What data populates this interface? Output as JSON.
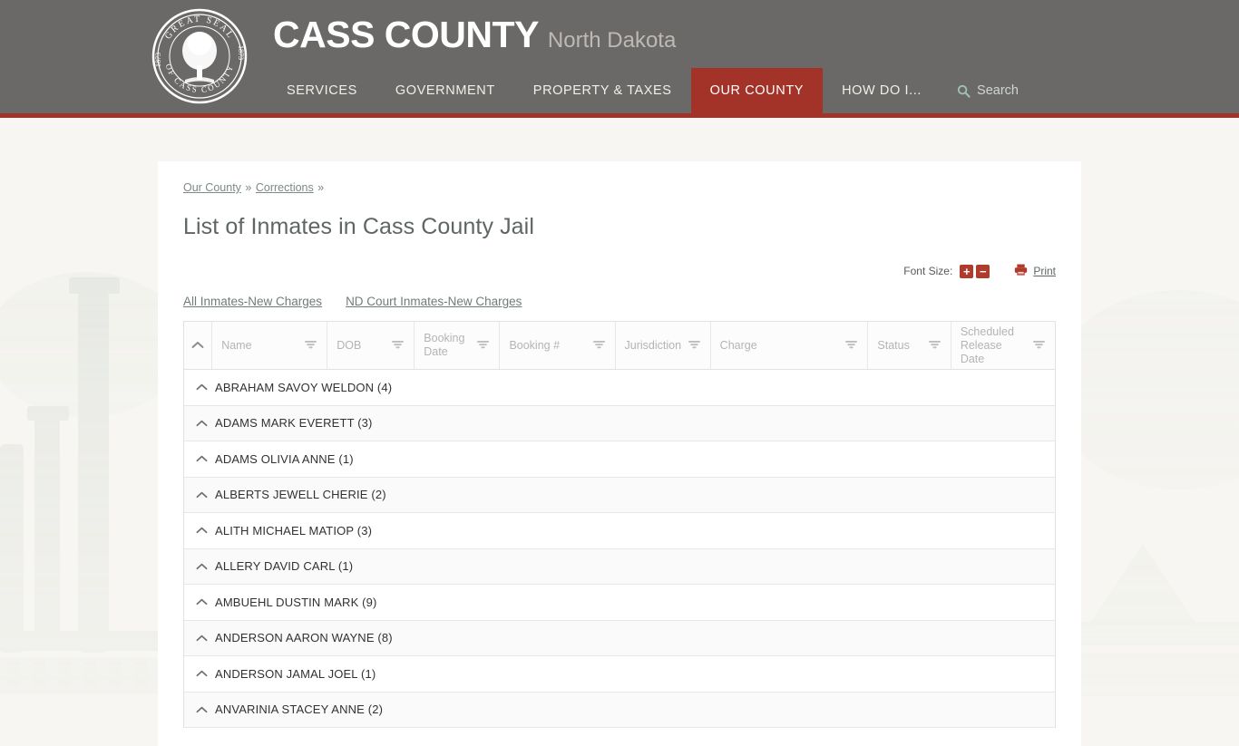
{
  "header": {
    "seal": {
      "top_text": "GREAT SEAL",
      "bottom_text": "OF CASS COUNTY",
      "year_left": "1873",
      "year_right": "1873"
    },
    "brand_main": "CASS COUNTY",
    "brand_sub": "North Dakota",
    "nav": [
      {
        "label": "SERVICES",
        "active": false
      },
      {
        "label": "GOVERNMENT",
        "active": false
      },
      {
        "label": "PROPERTY & TAXES",
        "active": false
      },
      {
        "label": "OUR COUNTY",
        "active": true
      },
      {
        "label": "HOW DO I...",
        "active": false
      }
    ],
    "search_label": "Search",
    "search_icon": "search-icon",
    "accent_color": "#a33328",
    "bar_color": "#6b6967"
  },
  "breadcrumb": {
    "items": [
      "Our County",
      "Corrections"
    ],
    "separator": "»"
  },
  "page_title": "List of Inmates in Cass County Jail",
  "tools": {
    "font_size_label": "Font Size:",
    "increase_label": "+",
    "decrease_label": "−",
    "print_label": "Print",
    "print_icon": "printer-icon",
    "button_color": "#b03a2b"
  },
  "subtabs": [
    {
      "label": "All Inmates-New Charges"
    },
    {
      "label": "ND Court Inmates-New Charges"
    }
  ],
  "grid": {
    "collapse_icon": "chevron-up-icon",
    "filter_icon": "filter-icon",
    "columns": [
      {
        "label": "",
        "key": "collapse",
        "class": "c-collapse",
        "filter": false
      },
      {
        "label": "Name",
        "key": "name",
        "class": "c-name",
        "filter": true
      },
      {
        "label": "DOB",
        "key": "dob",
        "class": "c-dob",
        "filter": true
      },
      {
        "label": "Booking Date",
        "key": "booking_date",
        "class": "c-bdate",
        "filter": true
      },
      {
        "label": "Booking #",
        "key": "booking_num",
        "class": "c-bnum",
        "filter": true
      },
      {
        "label": "Jurisdiction",
        "key": "jurisdiction",
        "class": "c-juris",
        "filter": true
      },
      {
        "label": "Charge",
        "key": "charge",
        "class": "c-charge",
        "filter": true
      },
      {
        "label": "Status",
        "key": "status",
        "class": "c-status",
        "filter": true
      },
      {
        "label": "Scheduled Release Date",
        "key": "release_date",
        "class": "c-release",
        "filter": true
      }
    ],
    "rows": [
      {
        "label": "ABRAHAM SAVOY WELDON (4)"
      },
      {
        "label": "ADAMS MARK EVERETT (3)"
      },
      {
        "label": "ADAMS OLIVIA ANNE (1)"
      },
      {
        "label": "ALBERTS JEWELL CHERIE (2)"
      },
      {
        "label": "ALITH MICHAEL MATIOP (3)"
      },
      {
        "label": "ALLERY DAVID CARL (1)"
      },
      {
        "label": "AMBUEHL DUSTIN MARK (9)"
      },
      {
        "label": "ANDERSON AARON WAYNE (8)"
      },
      {
        "label": "ANDERSON JAMAL JOEL (1)"
      },
      {
        "label": "ANVARINIA STACEY ANNE (2)"
      }
    ]
  }
}
